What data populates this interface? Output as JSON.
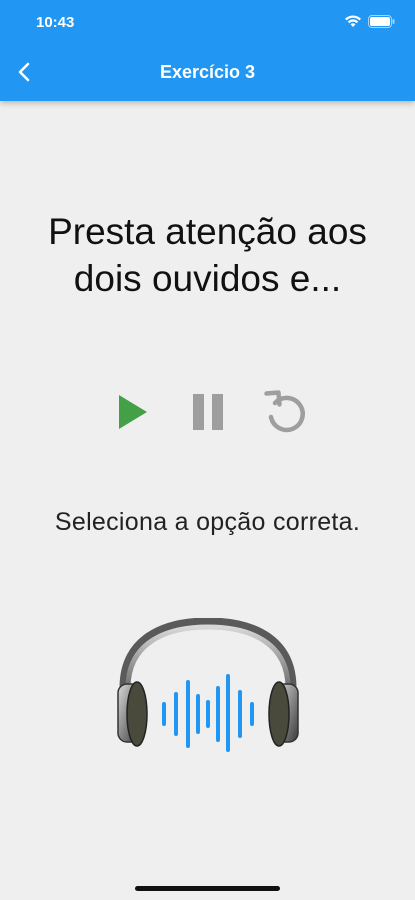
{
  "status_bar": {
    "time": "10:43"
  },
  "header": {
    "title": "Exercício 3"
  },
  "prompt": {
    "text": "Presta atenção aos dois ouvidos e..."
  },
  "controls": {
    "play_color": "#43a047",
    "pause_color": "#9e9e9e",
    "replay_color": "#9e9e9e"
  },
  "instruction": {
    "text": "Seleciona a opção correta."
  },
  "colors": {
    "accent": "#2196f3",
    "background": "#efefef",
    "wave": "#2196f3"
  }
}
